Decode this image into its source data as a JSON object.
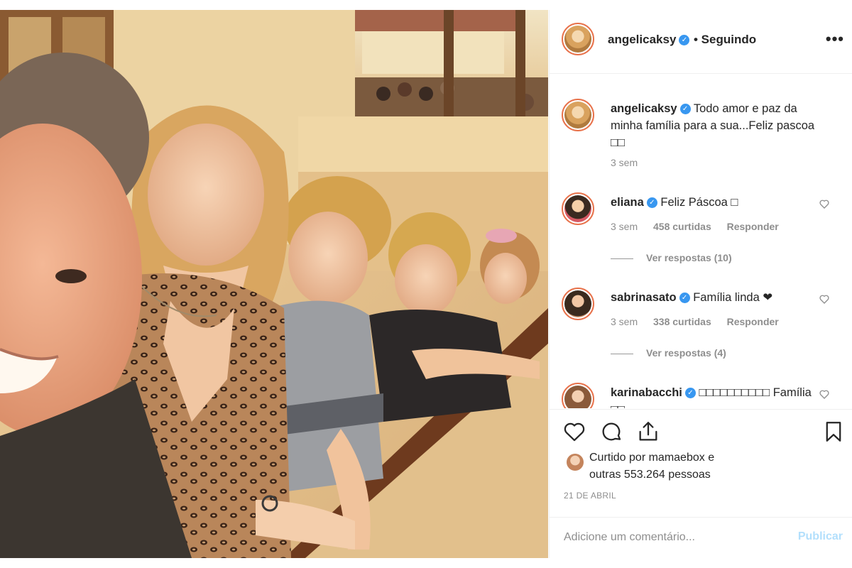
{
  "post": {
    "photo_alt": "photo-family-selfie"
  },
  "header": {
    "username": "angelicaksy",
    "verified_icon": "verified-badge-icon",
    "follow_status": "• Seguindo",
    "more_icon": "more-options-icon",
    "more_label": "•••"
  },
  "caption": {
    "username": "angelicaksy",
    "text": " Todo amor e paz da minha família para a sua...Feliz pascoa □□",
    "time": "3 sem"
  },
  "comments": [
    {
      "username": "eliana",
      "text": " Feliz Páscoa □",
      "time": "3 sem",
      "likes": "458 curtidas",
      "reply_label": "Responder",
      "view_replies": "Ver respostas (10)"
    },
    {
      "username": "sabrinasato",
      "text": " Família linda ❤",
      "time": "3 sem",
      "likes": "338 curtidas",
      "reply_label": "Responder",
      "view_replies": "Ver respostas (4)"
    },
    {
      "username": "karinabacchi",
      "text": " □□□□□□□□□□ Família □□"
    }
  ],
  "actions": {
    "like_icon": "heart-icon",
    "comment_icon": "comment-icon",
    "share_icon": "share-icon",
    "save_icon": "bookmark-icon"
  },
  "likes_summary": {
    "line1": "Curtido por mamaebox e",
    "line2": "outras 553.264 pessoas"
  },
  "date": "21 DE ABRIL",
  "add_comment": {
    "placeholder": "Adicione um comentário...",
    "publish_label": "Publicar"
  },
  "colors": {
    "verified": "#3897f0",
    "story_ring": "#e8724b",
    "publish_disabled": "#b2dffc",
    "secondary_text": "#8e8e8e"
  }
}
